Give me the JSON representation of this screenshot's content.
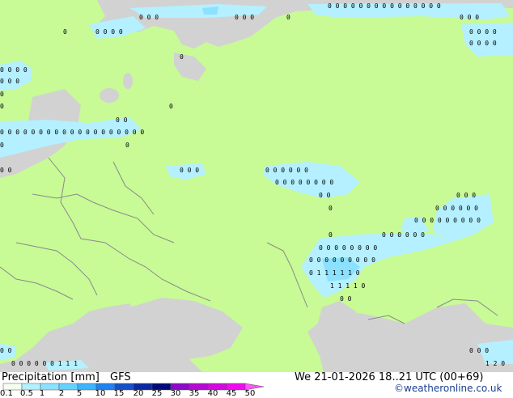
{
  "footer": {
    "title": "Precipitation [mm]",
    "model": "GFS",
    "datetime": "We 21-01-2026 18..21 UTC (00+69)",
    "watermark": "©weatheronline.co.uk"
  },
  "legend": {
    "ticks": [
      "0.1",
      "0.5",
      "1",
      "2",
      "5",
      "10",
      "15",
      "20",
      "25",
      "30",
      "35",
      "40",
      "45",
      "50"
    ],
    "colors": [
      "#f5fff0",
      "#b4f0ff",
      "#8ce1ff",
      "#64d2ff",
      "#3cb4ff",
      "#1e82f0",
      "#1450c8",
      "#0a28a0",
      "#000a78",
      "#8c0ac8",
      "#b40ad2",
      "#d20ae1",
      "#f00af0",
      "#ff55ff"
    ]
  },
  "map": {
    "colors": {
      "land": "#c8fa96",
      "sea": "#d2d2d2",
      "precip_light": "#b4f0ff",
      "precip_moderate": "#8ce1ff",
      "border": "#8a8a8a",
      "coast": "#7a7a7a"
    },
    "labels": [
      {
        "name": "north-sea-cluster-label",
        "text": "0 0 0"
      },
      {
        "name": "barents-label",
        "text": "0 0 0 0"
      },
      {
        "name": "kara-label",
        "text": "0 0 0 0 0"
      },
      {
        "name": "baltic-label",
        "text": "0 0 0 0 0 0"
      },
      {
        "name": "volga-label",
        "text": "0 0 0 0 0"
      },
      {
        "name": "kazakh-label",
        "text": "1 1 1 1 1"
      }
    ]
  }
}
